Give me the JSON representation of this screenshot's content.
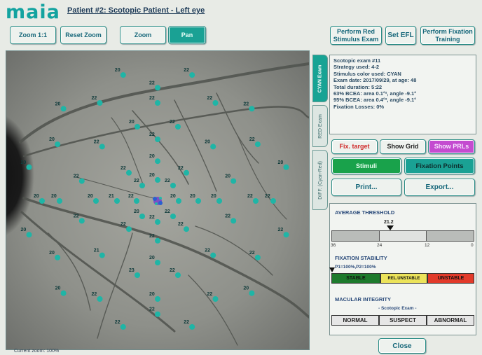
{
  "app": {
    "logo": "maia",
    "title": "Patient #2: Scotopic Patient - Left eye"
  },
  "toolbar": {
    "zoom11": "Zoom 1:1",
    "reset_zoom": "Reset Zoom",
    "zoom": "Zoom",
    "pan": "Pan"
  },
  "top_right": {
    "perform_red": "Perform Red Stimulus Exam",
    "set_efl": "Set EFL",
    "fixation_training": "Perform Fixation Training"
  },
  "tabs": [
    {
      "label": "CYAN Exam"
    },
    {
      "label": "RED Exam"
    },
    {
      "label": "DIFF. (Cyan-Red)"
    }
  ],
  "exam_info": [
    "Scotopic exam #11",
    "Strategy used: 4-2",
    "Stimulus color used: CYAN",
    "Exam date: 2017/09/29, at age: 48",
    "Total duration: 5:22",
    "63% BCEA: area 0.1°², angle -9.1°",
    "95% BCEA: area 0.4°², angle -9.1°",
    "Fixation Losses: 0%"
  ],
  "buttons": {
    "fix_target": "Fix. target",
    "show_grid": "Show Grid",
    "show_prls": "Show PRLs",
    "stimuli": "Stimuli",
    "fixation_points": "Fixation Points",
    "print": "Print...",
    "export": "Export...",
    "close": "Close"
  },
  "average_threshold": {
    "label": "AVERAGE THRESHOLD",
    "value": "21.2",
    "ticks": [
      "36",
      "24",
      "12",
      "0"
    ],
    "level_db": 21.2
  },
  "fixation_stability": {
    "label": "FIXATION STABILITY",
    "p_text": "P1=100%,P2=100%",
    "stable": "STABLE",
    "rel_unstable": "REL.UNSTABLE",
    "unstable": "UNSTABLE"
  },
  "macular_integrity": {
    "label": "MACULAR INTEGRITY",
    "sub": "- Scotopic Exam -",
    "normal": "NORMAL",
    "suspect": "SUSPECT",
    "abnormal": "ABNORMAL"
  },
  "status": {
    "current_zoom": "Current zoom: 100%"
  },
  "stimulus_points": [
    {
      "v": "22"
    },
    {
      "v": "22"
    },
    {
      "v": "22"
    },
    {
      "v": "22"
    },
    {
      "v": "20"
    },
    {
      "v": "22"
    },
    {
      "v": "21"
    },
    {
      "v": "20"
    },
    {
      "v": "22"
    },
    {
      "v": "22"
    },
    {
      "v": "22"
    },
    {
      "v": "23"
    },
    {
      "v": "21"
    },
    {
      "v": "22"
    },
    {
      "v": "22"
    },
    {
      "v": "22"
    },
    {
      "v": "20"
    },
    {
      "v": "22"
    },
    {
      "v": "20"
    },
    {
      "v": "20"
    },
    {
      "v": "22"
    },
    {
      "v": "22"
    },
    {
      "v": "22"
    },
    {
      "v": "22"
    },
    {
      "v": "22"
    },
    {
      "v": "20"
    },
    {
      "v": "20"
    },
    {
      "v": "20"
    },
    {
      "v": "22"
    },
    {
      "v": "22"
    },
    {
      "v": "22"
    },
    {
      "v": "22"
    },
    {
      "v": "22"
    },
    {
      "v": "20"
    },
    {
      "v": "22"
    },
    {
      "v": "22"
    },
    {
      "v": "20"
    },
    {
      "v": "20"
    },
    {
      "v": "20"
    },
    {
      "v": "20"
    },
    {
      "v": "20"
    },
    {
      "v": "22"
    },
    {
      "v": "22"
    },
    {
      "v": "20"
    },
    {
      "v": "20"
    },
    {
      "v": "22"
    },
    {
      "v": "22"
    },
    {
      "v": "20"
    },
    {
      "v": "22"
    },
    {
      "v": "22"
    },
    {
      "v": "20"
    },
    {
      "v": "22"
    },
    {
      "v": "22"
    },
    {
      "v": "20"
    },
    {
      "v": "20"
    },
    {
      "v": "20"
    },
    {
      "v": "22"
    },
    {
      "v": "20"
    },
    {
      "v": "20"
    },
    {
      "v": "22"
    }
  ]
}
